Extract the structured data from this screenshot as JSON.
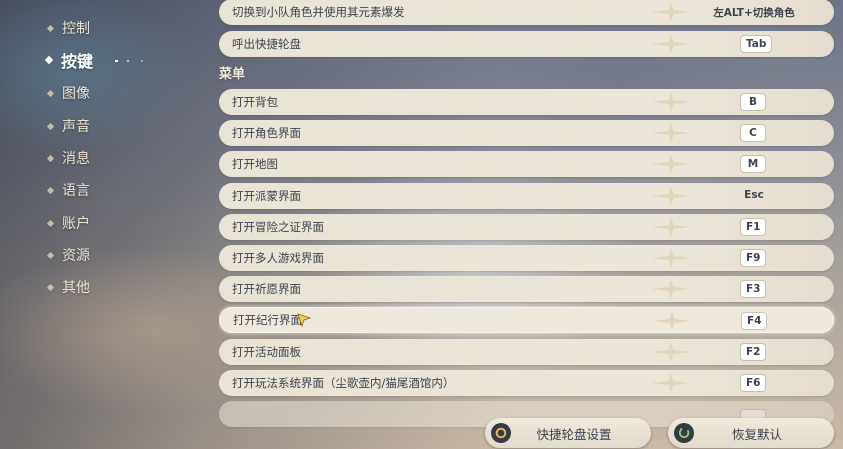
{
  "sidebar": {
    "items": [
      {
        "label": "控制",
        "active": false
      },
      {
        "label": "按键",
        "active": true
      },
      {
        "label": "图像",
        "active": false
      },
      {
        "label": "声音",
        "active": false
      },
      {
        "label": "消息",
        "active": false
      },
      {
        "label": "语言",
        "active": false
      },
      {
        "label": "账户",
        "active": false
      },
      {
        "label": "资源",
        "active": false
      },
      {
        "label": "其他",
        "active": false
      }
    ]
  },
  "keybinds": {
    "top_rows": [
      {
        "label": "切换到小队角色并使用其元素爆发",
        "key": "左ALT+切换角色"
      },
      {
        "label": "呼出快捷轮盘",
        "key": "Tab"
      }
    ],
    "section_title": "菜单",
    "menu_rows": [
      {
        "label": "打开背包",
        "key": "B"
      },
      {
        "label": "打开角色界面",
        "key": "C"
      },
      {
        "label": "打开地图",
        "key": "M"
      },
      {
        "label": "打开派蒙界面",
        "key": "Esc"
      },
      {
        "label": "打开冒险之证界面",
        "key": "F1"
      },
      {
        "label": "打开多人游戏界面",
        "key": "F9"
      },
      {
        "label": "打开祈愿界面",
        "key": "F3"
      },
      {
        "label": "打开纪行界面",
        "key": "F4",
        "selected": true
      },
      {
        "label": "打开活动面板",
        "key": "F2"
      },
      {
        "label": "打开玩法系统界面（尘歌壶内/猫尾酒馆内）",
        "key": "F6"
      }
    ]
  },
  "buttons": {
    "wheel_settings": "快捷轮盘设置",
    "restore_default": "恢复默认"
  },
  "colors": {
    "row_bg": "#ece6da",
    "text": "#3e4350",
    "keycap": "#ffffff",
    "icon_dark": "#363a44",
    "icon_gold": "#e0b85c",
    "icon_green": "#8fd07a"
  }
}
